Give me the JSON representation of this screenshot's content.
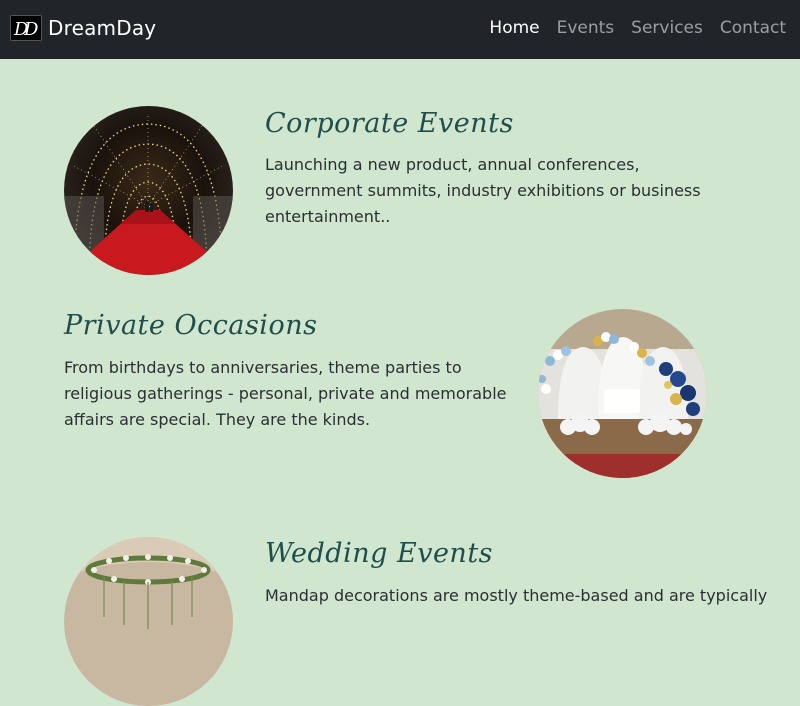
{
  "brand": {
    "name": "DreamDay",
    "logo_icon": "dd-monogram-icon"
  },
  "nav": {
    "items": [
      {
        "label": "Home",
        "active": true
      },
      {
        "label": "Events",
        "active": false
      },
      {
        "label": "Services",
        "active": false
      },
      {
        "label": "Contact",
        "active": false
      }
    ]
  },
  "sections": {
    "corporate": {
      "title": "Corporate Events",
      "text": "Launching a new product, annual conferences, government summits, industry exhibitions or business entertainment..",
      "image_icon": "light-tunnel-red-carpet-image"
    },
    "private": {
      "title": "Private Occasions",
      "text": "From birthdays to anniversaries, theme parties to religious gatherings - personal, private and memorable affairs are special. They are the kinds.",
      "image_icon": "balloon-stage-decor-image"
    },
    "wedding": {
      "title": "Wedding Events",
      "text": "Mandap decorations are mostly theme-based and are typically",
      "image_icon": "floral-mandap-image"
    }
  },
  "colors": {
    "background": "#d0e6cf",
    "navbar": "#212529",
    "heading": "#1f4e4c",
    "body_text": "#2a2f33"
  }
}
